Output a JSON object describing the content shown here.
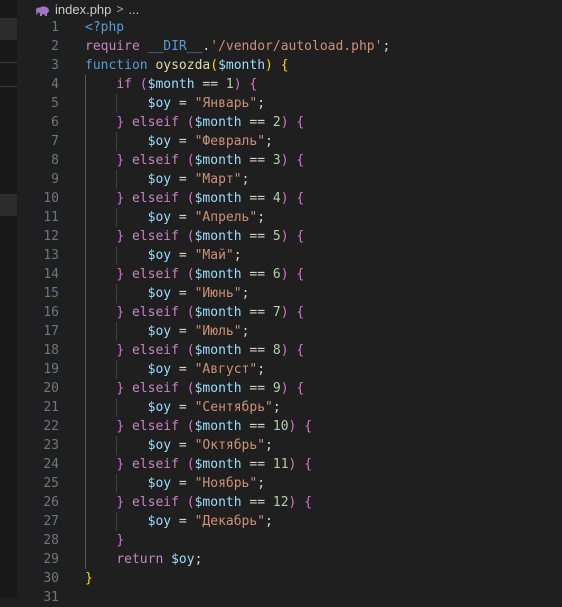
{
  "tab": {
    "filename": "index.php",
    "separator": ">",
    "ellipsis": "..."
  },
  "colors": {
    "background": "#1f1f1f",
    "line_number": "#6e7681",
    "keyword": "#c586c0",
    "function": "#dcdcaa",
    "variable": "#9cdcfe",
    "string": "#ce9178",
    "number": "#b5cea8",
    "php_icon": "#a074c4"
  },
  "code_lines": [
    {
      "n": "1",
      "tokens": [
        [
          "t-blue",
          "<?php"
        ]
      ]
    },
    {
      "n": "2",
      "tokens": [
        [
          "t-kw",
          "require"
        ],
        [
          "t-op",
          " "
        ],
        [
          "t-blue",
          "__DIR__"
        ],
        [
          "t-op",
          "."
        ],
        [
          "t-str",
          "'/vendor/autoload.php'"
        ],
        [
          "t-op",
          ";"
        ]
      ]
    },
    {
      "n": "3",
      "tokens": [
        [
          "t-blue",
          "function"
        ],
        [
          "t-op",
          " "
        ],
        [
          "t-fn",
          "oysozda"
        ],
        [
          "t-br1",
          "("
        ],
        [
          "t-var",
          "$month"
        ],
        [
          "t-br1",
          ")"
        ],
        [
          "t-op",
          " "
        ],
        [
          "t-br1",
          "{"
        ]
      ]
    },
    {
      "n": "4",
      "tokens": [
        [
          "t-op",
          "    "
        ],
        [
          "t-kw",
          "if"
        ],
        [
          "t-op",
          " "
        ],
        [
          "t-br2",
          "("
        ],
        [
          "t-var",
          "$month"
        ],
        [
          "t-op",
          " == "
        ],
        [
          "t-num",
          "1"
        ],
        [
          "t-br2",
          ")"
        ],
        [
          "t-op",
          " "
        ],
        [
          "t-br2",
          "{"
        ]
      ]
    },
    {
      "n": "5",
      "tokens": [
        [
          "t-op",
          "        "
        ],
        [
          "t-var",
          "$oy"
        ],
        [
          "t-op",
          " = "
        ],
        [
          "t-str",
          "\"Январь\""
        ],
        [
          "t-op",
          ";"
        ]
      ]
    },
    {
      "n": "6",
      "tokens": [
        [
          "t-op",
          "    "
        ],
        [
          "t-br2",
          "}"
        ],
        [
          "t-op",
          " "
        ],
        [
          "t-kw",
          "elseif"
        ],
        [
          "t-op",
          " "
        ],
        [
          "t-br2",
          "("
        ],
        [
          "t-var",
          "$month"
        ],
        [
          "t-op",
          " == "
        ],
        [
          "t-num",
          "2"
        ],
        [
          "t-br2",
          ")"
        ],
        [
          "t-op",
          " "
        ],
        [
          "t-br2",
          "{"
        ]
      ]
    },
    {
      "n": "7",
      "tokens": [
        [
          "t-op",
          "        "
        ],
        [
          "t-var",
          "$oy"
        ],
        [
          "t-op",
          " = "
        ],
        [
          "t-str",
          "\"Февраль\""
        ],
        [
          "t-op",
          ";"
        ]
      ]
    },
    {
      "n": "8",
      "tokens": [
        [
          "t-op",
          "    "
        ],
        [
          "t-br2",
          "}"
        ],
        [
          "t-op",
          " "
        ],
        [
          "t-kw",
          "elseif"
        ],
        [
          "t-op",
          " "
        ],
        [
          "t-br2",
          "("
        ],
        [
          "t-var",
          "$month"
        ],
        [
          "t-op",
          " == "
        ],
        [
          "t-num",
          "3"
        ],
        [
          "t-br2",
          ")"
        ],
        [
          "t-op",
          " "
        ],
        [
          "t-br2",
          "{"
        ]
      ]
    },
    {
      "n": "9",
      "tokens": [
        [
          "t-op",
          "        "
        ],
        [
          "t-var",
          "$oy"
        ],
        [
          "t-op",
          " = "
        ],
        [
          "t-str",
          "\"Март\""
        ],
        [
          "t-op",
          ";"
        ]
      ]
    },
    {
      "n": "10",
      "tokens": [
        [
          "t-op",
          "    "
        ],
        [
          "t-br2",
          "}"
        ],
        [
          "t-op",
          " "
        ],
        [
          "t-kw",
          "elseif"
        ],
        [
          "t-op",
          " "
        ],
        [
          "t-br2",
          "("
        ],
        [
          "t-var",
          "$month"
        ],
        [
          "t-op",
          " == "
        ],
        [
          "t-num",
          "4"
        ],
        [
          "t-br2",
          ")"
        ],
        [
          "t-op",
          " "
        ],
        [
          "t-br2",
          "{"
        ]
      ]
    },
    {
      "n": "11",
      "tokens": [
        [
          "t-op",
          "        "
        ],
        [
          "t-var",
          "$oy"
        ],
        [
          "t-op",
          " = "
        ],
        [
          "t-str",
          "\"Апрель\""
        ],
        [
          "t-op",
          ";"
        ]
      ]
    },
    {
      "n": "12",
      "tokens": [
        [
          "t-op",
          "    "
        ],
        [
          "t-br2",
          "}"
        ],
        [
          "t-op",
          " "
        ],
        [
          "t-kw",
          "elseif"
        ],
        [
          "t-op",
          " "
        ],
        [
          "t-br2",
          "("
        ],
        [
          "t-var",
          "$month"
        ],
        [
          "t-op",
          " == "
        ],
        [
          "t-num",
          "5"
        ],
        [
          "t-br2",
          ")"
        ],
        [
          "t-op",
          " "
        ],
        [
          "t-br2",
          "{"
        ]
      ]
    },
    {
      "n": "13",
      "tokens": [
        [
          "t-op",
          "        "
        ],
        [
          "t-var",
          "$oy"
        ],
        [
          "t-op",
          " = "
        ],
        [
          "t-str",
          "\"Май\""
        ],
        [
          "t-op",
          ";"
        ]
      ]
    },
    {
      "n": "14",
      "tokens": [
        [
          "t-op",
          "    "
        ],
        [
          "t-br2",
          "}"
        ],
        [
          "t-op",
          " "
        ],
        [
          "t-kw",
          "elseif"
        ],
        [
          "t-op",
          " "
        ],
        [
          "t-br2",
          "("
        ],
        [
          "t-var",
          "$month"
        ],
        [
          "t-op",
          " == "
        ],
        [
          "t-num",
          "6"
        ],
        [
          "t-br2",
          ")"
        ],
        [
          "t-op",
          " "
        ],
        [
          "t-br2",
          "{"
        ]
      ]
    },
    {
      "n": "15",
      "tokens": [
        [
          "t-op",
          "        "
        ],
        [
          "t-var",
          "$oy"
        ],
        [
          "t-op",
          " = "
        ],
        [
          "t-str",
          "\"Июнь\""
        ],
        [
          "t-op",
          ";"
        ]
      ]
    },
    {
      "n": "16",
      "tokens": [
        [
          "t-op",
          "    "
        ],
        [
          "t-br2",
          "}"
        ],
        [
          "t-op",
          " "
        ],
        [
          "t-kw",
          "elseif"
        ],
        [
          "t-op",
          " "
        ],
        [
          "t-br2",
          "("
        ],
        [
          "t-var",
          "$month"
        ],
        [
          "t-op",
          " == "
        ],
        [
          "t-num",
          "7"
        ],
        [
          "t-br2",
          ")"
        ],
        [
          "t-op",
          " "
        ],
        [
          "t-br2",
          "{"
        ]
      ]
    },
    {
      "n": "17",
      "tokens": [
        [
          "t-op",
          "        "
        ],
        [
          "t-var",
          "$oy"
        ],
        [
          "t-op",
          " = "
        ],
        [
          "t-str",
          "\"Июль\""
        ],
        [
          "t-op",
          ";"
        ]
      ]
    },
    {
      "n": "18",
      "tokens": [
        [
          "t-op",
          "    "
        ],
        [
          "t-br2",
          "}"
        ],
        [
          "t-op",
          " "
        ],
        [
          "t-kw",
          "elseif"
        ],
        [
          "t-op",
          " "
        ],
        [
          "t-br2",
          "("
        ],
        [
          "t-var",
          "$month"
        ],
        [
          "t-op",
          " == "
        ],
        [
          "t-num",
          "8"
        ],
        [
          "t-br2",
          ")"
        ],
        [
          "t-op",
          " "
        ],
        [
          "t-br2",
          "{"
        ]
      ]
    },
    {
      "n": "19",
      "tokens": [
        [
          "t-op",
          "        "
        ],
        [
          "t-var",
          "$oy"
        ],
        [
          "t-op",
          " = "
        ],
        [
          "t-str",
          "\"Август\""
        ],
        [
          "t-op",
          ";"
        ]
      ]
    },
    {
      "n": "20",
      "tokens": [
        [
          "t-op",
          "    "
        ],
        [
          "t-br2",
          "}"
        ],
        [
          "t-op",
          " "
        ],
        [
          "t-kw",
          "elseif"
        ],
        [
          "t-op",
          " "
        ],
        [
          "t-br2",
          "("
        ],
        [
          "t-var",
          "$month"
        ],
        [
          "t-op",
          " == "
        ],
        [
          "t-num",
          "9"
        ],
        [
          "t-br2",
          ")"
        ],
        [
          "t-op",
          " "
        ],
        [
          "t-br2",
          "{"
        ]
      ]
    },
    {
      "n": "21",
      "tokens": [
        [
          "t-op",
          "        "
        ],
        [
          "t-var",
          "$oy"
        ],
        [
          "t-op",
          " = "
        ],
        [
          "t-str",
          "\"Сентябрь\""
        ],
        [
          "t-op",
          ";"
        ]
      ]
    },
    {
      "n": "22",
      "tokens": [
        [
          "t-op",
          "    "
        ],
        [
          "t-br2",
          "}"
        ],
        [
          "t-op",
          " "
        ],
        [
          "t-kw",
          "elseif"
        ],
        [
          "t-op",
          " "
        ],
        [
          "t-br2",
          "("
        ],
        [
          "t-var",
          "$month"
        ],
        [
          "t-op",
          " == "
        ],
        [
          "t-num",
          "10"
        ],
        [
          "t-br2",
          ")"
        ],
        [
          "t-op",
          " "
        ],
        [
          "t-br2",
          "{"
        ]
      ]
    },
    {
      "n": "23",
      "tokens": [
        [
          "t-op",
          "        "
        ],
        [
          "t-var",
          "$oy"
        ],
        [
          "t-op",
          " = "
        ],
        [
          "t-str",
          "\"Октябрь\""
        ],
        [
          "t-op",
          ";"
        ]
      ]
    },
    {
      "n": "24",
      "tokens": [
        [
          "t-op",
          "    "
        ],
        [
          "t-br2",
          "}"
        ],
        [
          "t-op",
          " "
        ],
        [
          "t-kw",
          "elseif"
        ],
        [
          "t-op",
          " "
        ],
        [
          "t-br2",
          "("
        ],
        [
          "t-var",
          "$month"
        ],
        [
          "t-op",
          " == "
        ],
        [
          "t-num",
          "11"
        ],
        [
          "t-br2",
          ")"
        ],
        [
          "t-op",
          " "
        ],
        [
          "t-br2",
          "{"
        ]
      ]
    },
    {
      "n": "25",
      "tokens": [
        [
          "t-op",
          "        "
        ],
        [
          "t-var",
          "$oy"
        ],
        [
          "t-op",
          " = "
        ],
        [
          "t-str",
          "\"Ноябрь\""
        ],
        [
          "t-op",
          ";"
        ]
      ]
    },
    {
      "n": "26",
      "tokens": [
        [
          "t-op",
          "    "
        ],
        [
          "t-br2",
          "}"
        ],
        [
          "t-op",
          " "
        ],
        [
          "t-kw",
          "elseif"
        ],
        [
          "t-op",
          " "
        ],
        [
          "t-br2",
          "("
        ],
        [
          "t-var",
          "$month"
        ],
        [
          "t-op",
          " == "
        ],
        [
          "t-num",
          "12"
        ],
        [
          "t-br2",
          ")"
        ],
        [
          "t-op",
          " "
        ],
        [
          "t-br2",
          "{"
        ]
      ]
    },
    {
      "n": "27",
      "tokens": [
        [
          "t-op",
          "        "
        ],
        [
          "t-var",
          "$oy"
        ],
        [
          "t-op",
          " = "
        ],
        [
          "t-str",
          "\"Декабрь\""
        ],
        [
          "t-op",
          ";"
        ]
      ]
    },
    {
      "n": "28",
      "tokens": [
        [
          "t-op",
          "    "
        ],
        [
          "t-br2",
          "}"
        ]
      ]
    },
    {
      "n": "29",
      "tokens": [
        [
          "t-op",
          "    "
        ],
        [
          "t-kw",
          "return"
        ],
        [
          "t-op",
          " "
        ],
        [
          "t-var",
          "$oy"
        ],
        [
          "t-op",
          ";"
        ]
      ]
    },
    {
      "n": "30",
      "tokens": [
        [
          "t-br1",
          "}"
        ]
      ]
    },
    {
      "n": "31",
      "tokens": []
    }
  ]
}
